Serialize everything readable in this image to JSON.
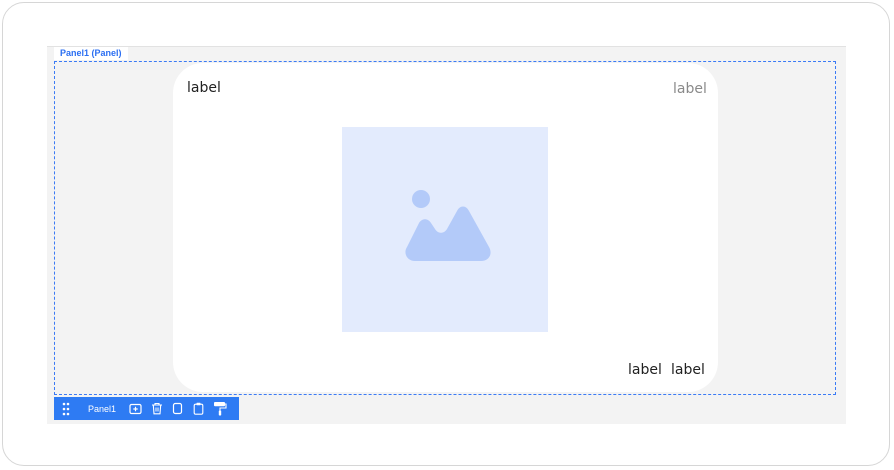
{
  "panel": {
    "tag": "Panel1 (Panel)",
    "name": "Panel1"
  },
  "card": {
    "label_top_left": "label",
    "label_top_right": "label",
    "label_bottom_1": "label",
    "label_bottom_2": "label",
    "image_icon": "image-placeholder-icon"
  },
  "toolbar": {
    "name": "Panel1",
    "icons": [
      "drag-handle-icon",
      "add-icon",
      "trash-icon",
      "copy-icon",
      "clipboard-icon",
      "paint-roller-icon"
    ]
  },
  "colors": {
    "accent": "#2e7bf3",
    "canvas": "#f3f3f3",
    "image_bg": "#e3ebfd",
    "image_icon": "#b3caf9"
  }
}
